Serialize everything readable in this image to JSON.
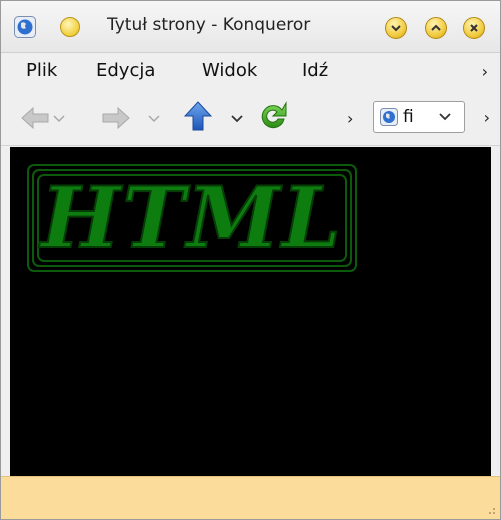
{
  "window": {
    "title": "Tytuł strony - Konqueror",
    "app_icon": "konqueror-globe-icon",
    "buttons": [
      "minimize-button",
      "maximize-button",
      "close-button"
    ]
  },
  "menu": {
    "items": [
      {
        "label": "Plik"
      },
      {
        "label": "Edycja"
      },
      {
        "label": "Widok"
      },
      {
        "label": "Idź"
      }
    ],
    "overflow": "›"
  },
  "toolbar": {
    "overflow": "›",
    "separator": "›",
    "location_text": "fi"
  },
  "content": {
    "background": "#000000",
    "banner_text": "HTML",
    "banner_color": "#0f7a0f"
  },
  "statusbar": {
    "background": "#fcdc9a"
  }
}
